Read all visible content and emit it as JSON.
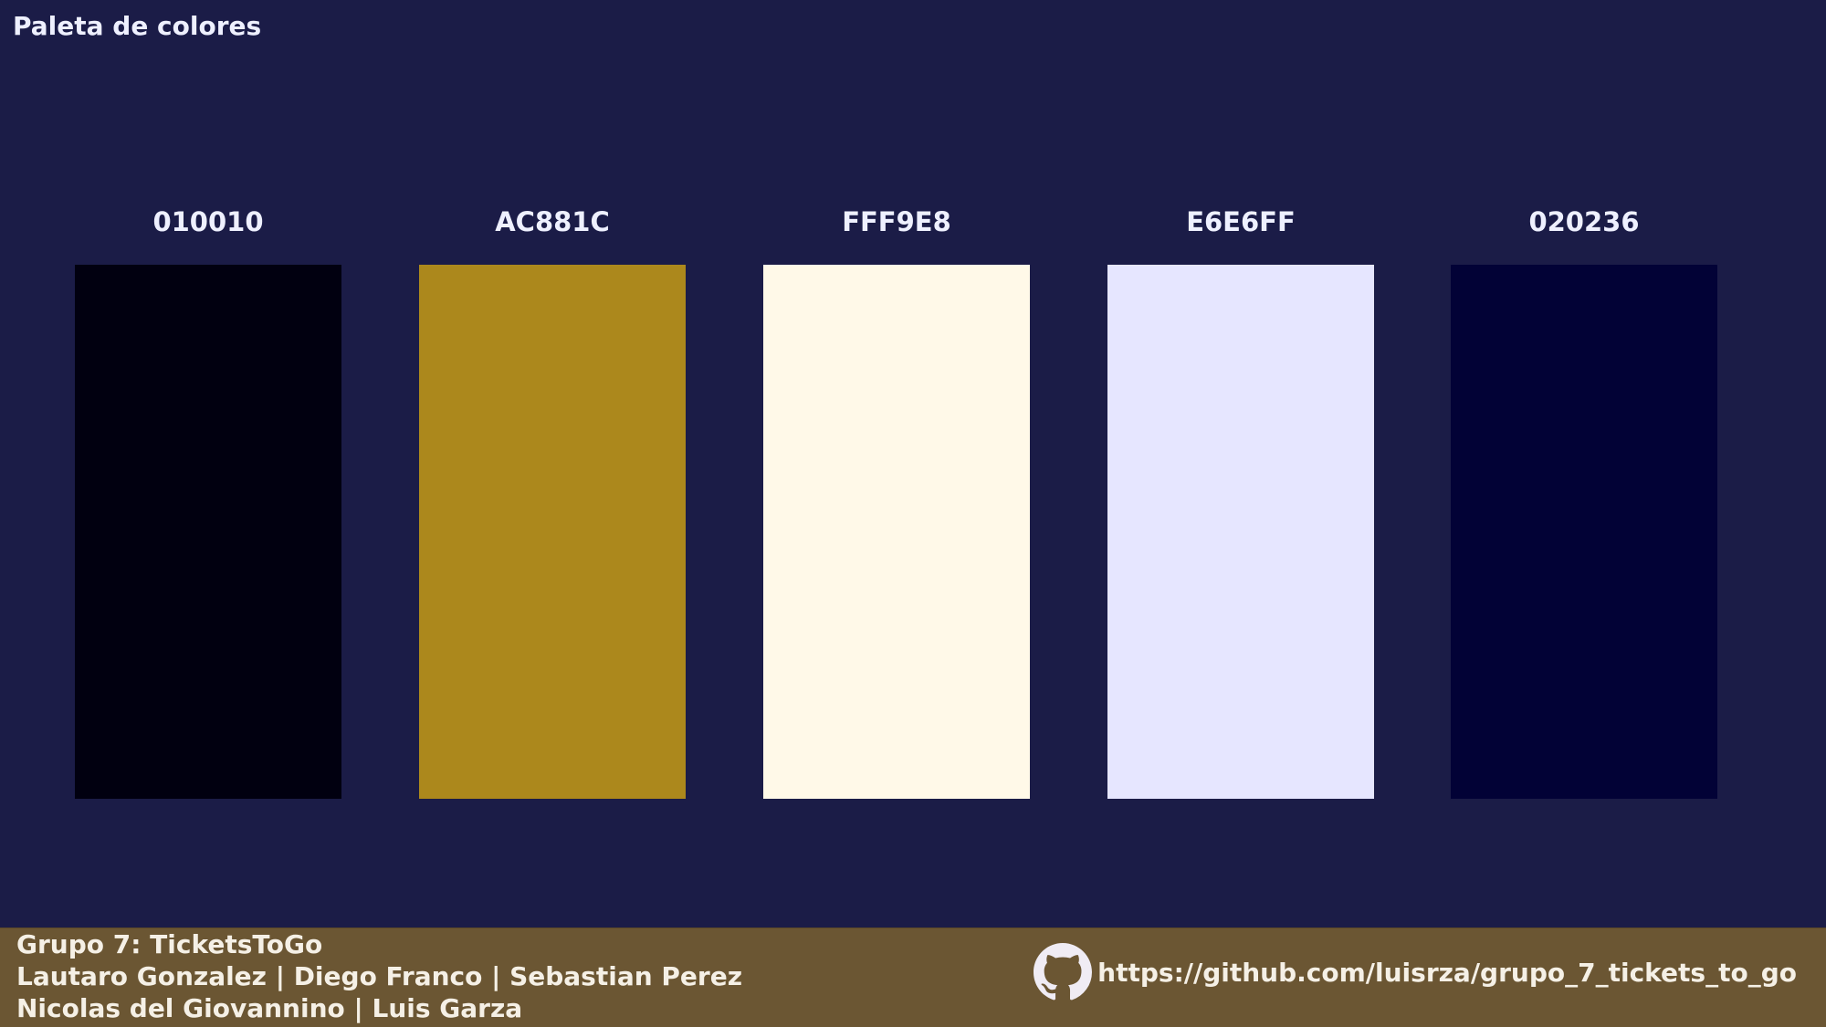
{
  "page": {
    "title": "Paleta de colores"
  },
  "palette": {
    "swatches": [
      {
        "label": "010010",
        "color": "#010010"
      },
      {
        "label": "AC881C",
        "color": "#AC881C"
      },
      {
        "label": "FFF9E8",
        "color": "#FFF9E8"
      },
      {
        "label": "E6E6FF",
        "color": "#E6E6FF"
      },
      {
        "label": "020236",
        "color": "#020236"
      }
    ]
  },
  "footer": {
    "group": "Grupo 7: TicketsToGo",
    "members_line1": "Lautaro Gonzalez | Diego Franco | Sebastian Perez",
    "members_line2": "Nicolas del Giovannino | Luis Garza",
    "repo_icon": "github-icon",
    "repo_url": "https://github.com/luisrza/grupo_7_tickets_to_go"
  },
  "colors": {
    "background": "#1b1c47",
    "footer_background": "#6b5633",
    "text": "#eef0ff"
  }
}
